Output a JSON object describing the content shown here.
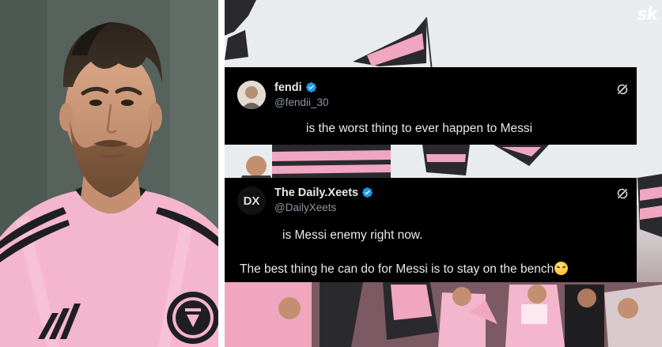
{
  "watermark": "sk",
  "left_photo": {
    "jersey_crest_text": "CLUB INTERNACIONAL DE FÚTBOL MIAMI MMXX"
  },
  "tweets": [
    {
      "display_name": "fendi",
      "handle": "@fendii_30",
      "avatar_icon": "profile-photo",
      "verified": true,
      "lines": [
        "is the worst thing to ever happen to Messi"
      ]
    },
    {
      "display_name": "The Daily.Xeets",
      "handle": "@DailyXeets",
      "avatar_text": "DX",
      "verified": true,
      "lines": [
        "is Messi enemy right now.",
        "The best thing he can do for Messi is to stay on the bench"
      ],
      "trailing_emoji": "face-with-steam-icon"
    }
  ],
  "colors": {
    "card_background": "#000000",
    "text_primary": "#e7e9ea",
    "text_secondary": "#8b98a5",
    "verified_blue": "#1d9bf0",
    "jersey_pink": "#f4b6cc",
    "flag_pink": "#f1a6c0",
    "flag_black": "#2a2a2e"
  }
}
